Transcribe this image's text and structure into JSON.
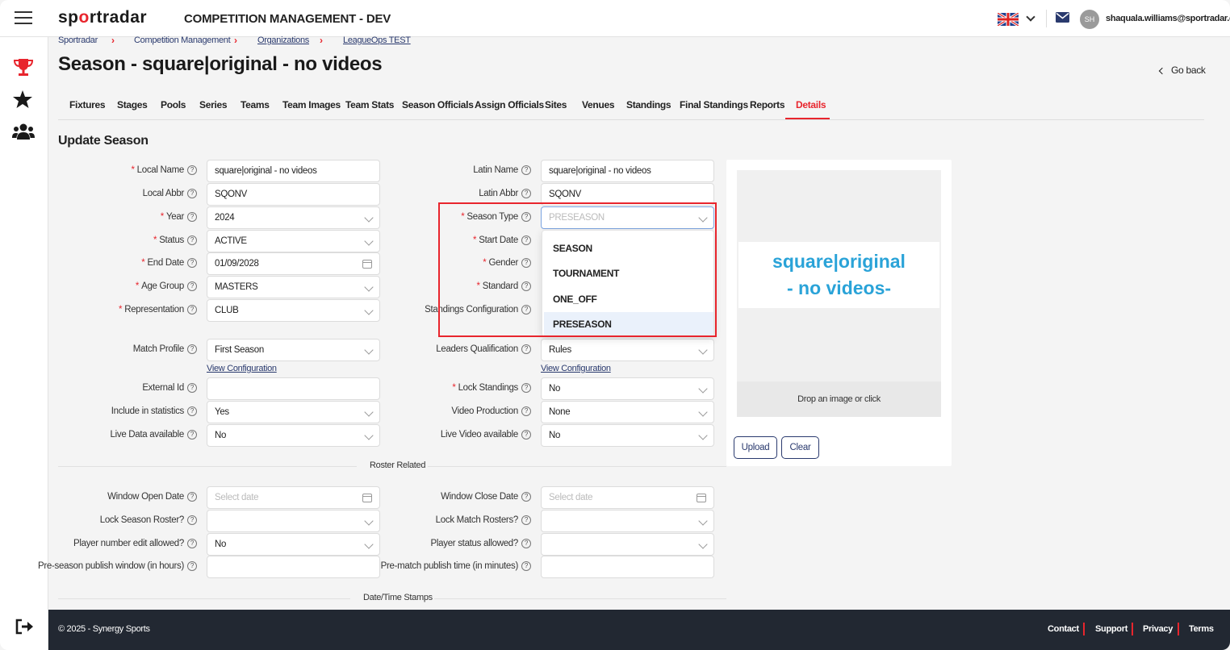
{
  "header": {
    "logo": {
      "pre": "sp",
      "o": "o",
      "post": "rtradar"
    },
    "app_title": "COMPETITION MANAGEMENT - DEV",
    "user_initials": "SH",
    "user_email": "shaquala.williams@sportradar.com",
    "flag_icon": "uk-flag-icon"
  },
  "breadcrumb": [
    "Sportradar",
    "Competition Management",
    "Organizations",
    "LeagueOps TEST"
  ],
  "page": {
    "title": "Season - square|original - no videos",
    "go_back": "Go back",
    "section_title": "Update Season"
  },
  "tabs": [
    "Fixtures",
    "Stages",
    "Pools",
    "Series",
    "Teams",
    "Team Images",
    "Team Stats",
    "Season Officials",
    "Assign Officials",
    "Sites",
    "Venues",
    "Standings",
    "Final Standings",
    "Reports",
    "Details"
  ],
  "active_tab": "Details",
  "left_fields": [
    {
      "label": "Local Name",
      "required": true,
      "value": "square|original - no videos",
      "kind": "text"
    },
    {
      "label": "Local Abbr",
      "required": false,
      "value": "SQONV",
      "kind": "text"
    },
    {
      "label": "Year",
      "required": true,
      "value": "2024",
      "kind": "select"
    },
    {
      "label": "Status",
      "required": true,
      "value": "ACTIVE",
      "kind": "select"
    },
    {
      "label": "End Date",
      "required": true,
      "value": "01/09/2028",
      "kind": "date"
    },
    {
      "label": "Age Group",
      "required": true,
      "value": "MASTERS",
      "kind": "select"
    },
    {
      "label": "Representation",
      "required": true,
      "value": "CLUB",
      "kind": "select"
    }
  ],
  "right_fields": [
    {
      "label": "Latin Name",
      "required": false,
      "value": "square|original - no videos"
    },
    {
      "label": "Latin Abbr",
      "required": false,
      "value": "SQONV"
    },
    {
      "label": "Season Type",
      "required": true,
      "placeholder": "PRESEASON"
    },
    {
      "label": "Start Date",
      "required": true
    },
    {
      "label": "Gender",
      "required": true
    },
    {
      "label": "Standard",
      "required": true
    },
    {
      "label": "Standings Configuration",
      "required": false
    }
  ],
  "season_type_options": [
    "SEASON",
    "TOURNAMENT",
    "ONE_OFF",
    "PRESEASON"
  ],
  "season_type_selected": "PRESEASON",
  "match_profile": {
    "label": "Match Profile",
    "value": "First Season",
    "link": "View Configuration"
  },
  "leaders_qualification": {
    "label": "Leaders Qualification",
    "value": "Rules",
    "link": "View Configuration"
  },
  "left_more": [
    {
      "label": "External Id",
      "value": ""
    },
    {
      "label": "Include in statistics",
      "value": "Yes"
    },
    {
      "label": "Live Data available",
      "value": "No"
    }
  ],
  "right_more": [
    {
      "label": "Lock Standings",
      "required": true,
      "value": "No"
    },
    {
      "label": "Video Production",
      "value": "None"
    },
    {
      "label": "Live Video available",
      "value": "No"
    }
  ],
  "roster_section": "Roster Related",
  "roster_left": [
    {
      "label": "Window Open Date",
      "placeholder": "Select date"
    },
    {
      "label": "Lock Season Roster?",
      "value": ""
    },
    {
      "label": "Player number edit allowed?",
      "value": "No"
    },
    {
      "label": "Pre-season publish window (in hours)",
      "value": ""
    }
  ],
  "roster_right": [
    {
      "label": "Window Close Date",
      "placeholder": "Select date"
    },
    {
      "label": "Lock Match Rosters?",
      "value": ""
    },
    {
      "label": "Player status allowed?",
      "value": ""
    },
    {
      "label": "Pre-match publish time (in minutes)",
      "value": ""
    }
  ],
  "timestamps_section": "Date/Time Stamps",
  "image_panel": {
    "line1": "square|original",
    "line2": "- no videos-",
    "drop_text": "Drop an image or click",
    "upload": "Upload",
    "clear": "Clear"
  },
  "footer": {
    "copyright": "© 2025 - Synergy Sports",
    "links": [
      "Contact",
      "Support",
      "Privacy",
      "Terms"
    ]
  },
  "colors": {
    "accent": "#e8252d",
    "navy": "#2a3a6e",
    "footer": "#222832",
    "image_text": "#2aa3d8"
  }
}
